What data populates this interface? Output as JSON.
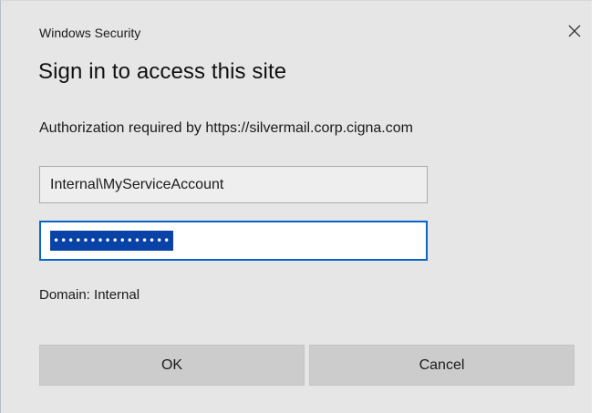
{
  "window": {
    "caption": "Windows Security",
    "close_icon": "close-icon"
  },
  "dialog": {
    "title": "Sign in to access this site",
    "message": "Authorization required by https://silvermail.corp.cigna.com"
  },
  "form": {
    "username_value": "Internal\\MyServiceAccount",
    "password_masked": "••••••••••••••••",
    "domain_text": "Domain: Internal"
  },
  "buttons": {
    "ok_label": "OK",
    "cancel_label": "Cancel"
  },
  "colors": {
    "dialog_background": "#e6e6e6",
    "focus_border": "#0a64c8",
    "selection_highlight": "#0a43a8",
    "button_background": "#cccccc"
  }
}
